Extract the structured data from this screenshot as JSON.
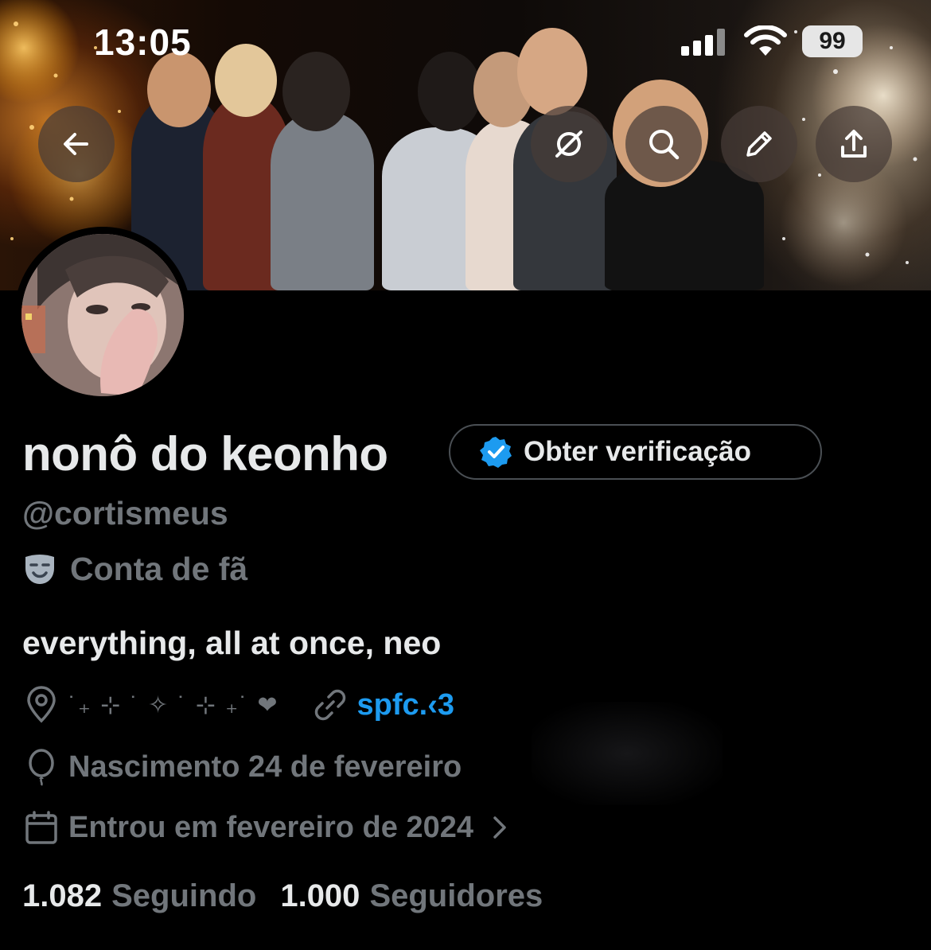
{
  "status_bar": {
    "time": "13:05",
    "battery": "99"
  },
  "banner": {
    "buttons": {
      "back_icon": "arrow-left-icon",
      "grok_icon": "grok-icon",
      "search_icon": "search-icon",
      "edit_icon": "pencil-icon",
      "share_icon": "share-icon"
    }
  },
  "profile": {
    "display_name": "nonô do keonho",
    "get_verified_label": "Obter verificação",
    "handle": "@cortismeus",
    "category": "Conta de fã",
    "bio": "everything, all at once, neo",
    "location": "˙₊ ⊹ ˙ ✧ ˙ ⊹ ₊˙ ❤",
    "website": "spfc.‹3",
    "birth": "Nascimento 24 de fevereiro",
    "joined": "Entrou em fevereiro de 2024",
    "following_count": "1.082",
    "following_label": "Seguindo",
    "followers_count": "1.000",
    "followers_label": "Seguidores"
  },
  "colors": {
    "accent": "#1d9bf0",
    "muted": "#71767b",
    "text": "#e7e9ea",
    "background": "#000000"
  }
}
